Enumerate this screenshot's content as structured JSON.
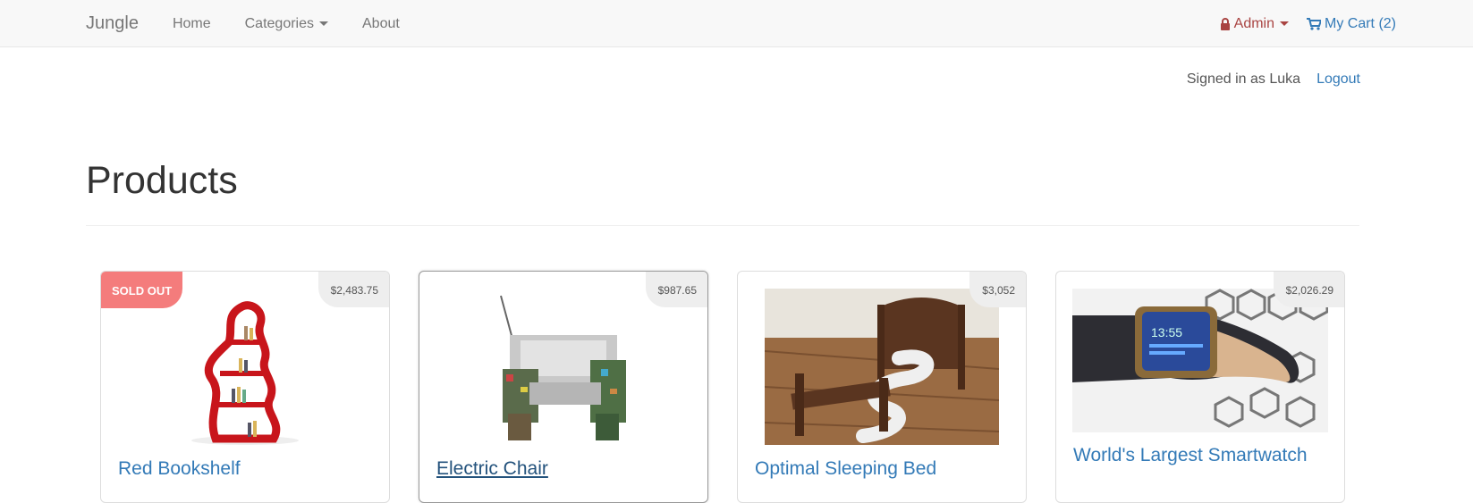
{
  "navbar": {
    "brand": "Jungle",
    "links": [
      "Home",
      "Categories",
      "About"
    ],
    "admin_label": "Admin",
    "cart_label": "My Cart (2)"
  },
  "session": {
    "signed_in_text": "Signed in as Luka",
    "logout_label": "Logout"
  },
  "page": {
    "title": "Products"
  },
  "products": [
    {
      "name": "Red Bookshelf",
      "price": "$2,483.75",
      "badge": "SOLD OUT"
    },
    {
      "name": "Electric Chair",
      "price": "$987.65"
    },
    {
      "name": "Optimal Sleeping Bed",
      "price": "$3,052"
    },
    {
      "name": "World's Largest Smartwatch",
      "price": "$2,026.29"
    }
  ],
  "colors": {
    "link": "#337ab7",
    "admin": "#a94442",
    "sold_badge": "#f47c7c"
  }
}
